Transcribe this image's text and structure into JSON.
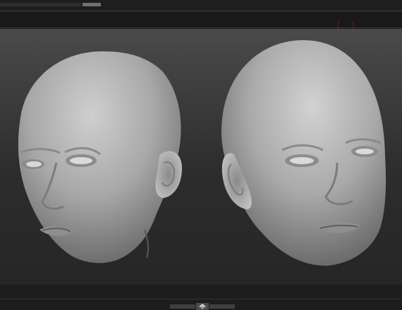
{
  "app": {
    "accent_color": "#7a1d1d",
    "viewport_background": "#3a3a3a"
  },
  "toolbar": {
    "record_icon_name": "record-icon"
  },
  "viewport": {
    "models": [
      {
        "name": "head-sculpt-left"
      },
      {
        "name": "head-sculpt-right"
      }
    ]
  },
  "bottom": {
    "scroll_handle_icon": "chevron-up-down-icon"
  }
}
